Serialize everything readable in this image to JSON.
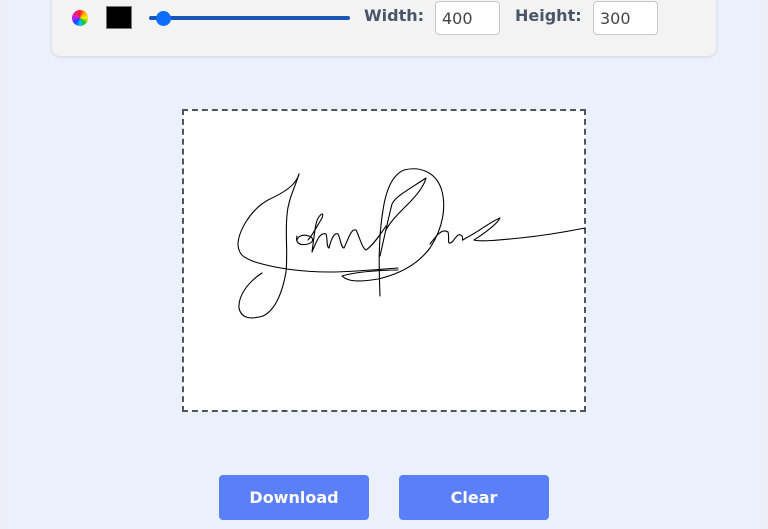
{
  "toolbar": {
    "color_picker_icon": "color-wheel",
    "stroke_color": "#000000",
    "stroke_width_fraction": 0.04,
    "width_label": "Width:",
    "width_value": "400",
    "height_label": "Height:",
    "height_value": "300"
  },
  "canvas": {
    "content": "handwritten signature 'John Doe'",
    "stroke_color": "#000000"
  },
  "actions": {
    "download_label": "Download",
    "clear_label": "Clear"
  },
  "colors": {
    "button": "#5b7ff8",
    "slider": "#1a56b8",
    "slider_thumb": "#0d6efd",
    "label": "#4a5568",
    "background": "#ebf0fb"
  }
}
